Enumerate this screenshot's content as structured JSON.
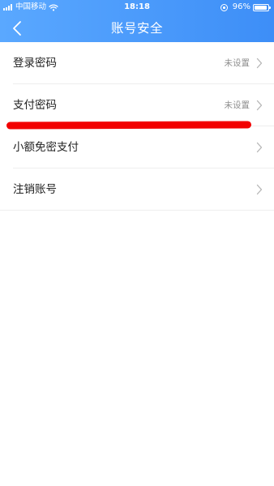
{
  "status_bar": {
    "carrier": "中国移动",
    "time": "18:18",
    "battery": "96%"
  },
  "nav": {
    "title": "账号安全",
    "back_icon": "chevron-left-icon"
  },
  "settings": {
    "items": [
      {
        "label": "登录密码",
        "value": "未设置"
      },
      {
        "label": "支付密码",
        "value": "未设置"
      },
      {
        "label": "小额免密支付",
        "value": ""
      },
      {
        "label": "注销账号",
        "value": ""
      }
    ]
  },
  "colors": {
    "header_start": "#5aa8ff",
    "header_end": "#3d8ef7",
    "annotation": "#f20000",
    "label_text": "#222222",
    "value_text": "#8e8e8e"
  }
}
